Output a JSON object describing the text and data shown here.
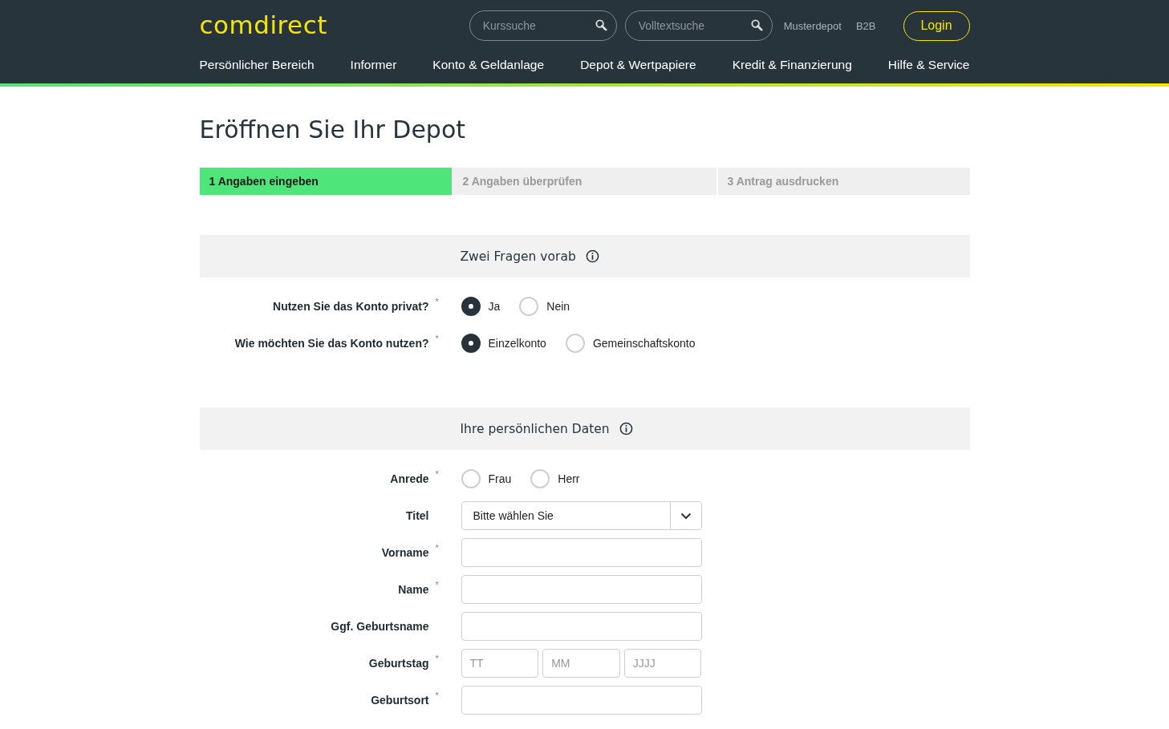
{
  "header": {
    "logo": "comdirect",
    "searches": [
      {
        "placeholder": "Kurssuche"
      },
      {
        "placeholder": "Volltextsuche"
      }
    ],
    "links": [
      "Musterdepot",
      "B2B"
    ],
    "login": "Login",
    "nav": [
      "Persönlicher Bereich",
      "Informer",
      "Konto & Geldanlage",
      "Depot & Wertpapiere",
      "Kredit & Finanzierung",
      "Hilfe & Service"
    ]
  },
  "title": "Eröffnen Sie Ihr Depot",
  "steps": [
    {
      "label": "1 Angaben eingeben",
      "selected": true
    },
    {
      "label": "2 Angaben überprüfen",
      "selected": false
    },
    {
      "label": "3 Antrag ausdrucken",
      "selected": false
    }
  ],
  "sections": [
    {
      "title": "Zwei Fragen vorab",
      "rows": [
        {
          "kind": "radio",
          "label": "Nutzen Sie das Konto privat?",
          "mark": "*",
          "options": [
            {
              "label": "Ja",
              "selected": true
            },
            {
              "label": "Nein",
              "selected": false
            }
          ]
        },
        {
          "kind": "radio",
          "label": "Wie möchten Sie das Konto nutzen?",
          "mark": "*",
          "options": [
            {
              "label": "Einzelkonto",
              "selected": true
            },
            {
              "label": "Gemeinschaftskonto",
              "selected": false
            }
          ]
        }
      ]
    },
    {
      "title": "Ihre persönlichen Daten",
      "rows": [
        {
          "kind": "radio",
          "label": "Anrede",
          "mark": "*",
          "options": [
            {
              "label": "Frau",
              "selected": false
            },
            {
              "label": "Herr",
              "selected": false
            }
          ]
        },
        {
          "kind": "select",
          "label": "Titel",
          "value": "Bitte wählen Sie"
        },
        {
          "kind": "text",
          "label": "Vorname",
          "mark": "*"
        },
        {
          "kind": "text",
          "label": "Name",
          "mark": "*"
        },
        {
          "kind": "text",
          "label": "Ggf. Geburtsname"
        },
        {
          "kind": "date",
          "label": "Geburtstag",
          "mark": "*",
          "parts": [
            {
              "placeholder": "TT"
            },
            {
              "placeholder": "MM"
            },
            {
              "placeholder": "JJJJ"
            }
          ]
        },
        {
          "kind": "text",
          "label": "Geburtsort",
          "mark": "*"
        }
      ]
    }
  ]
}
